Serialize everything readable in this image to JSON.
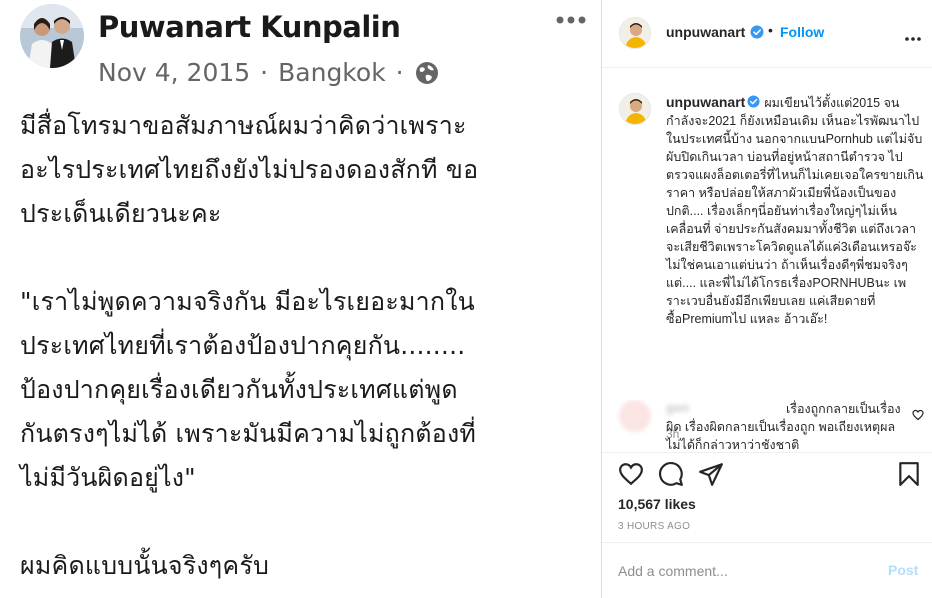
{
  "post_image": {
    "author": "Puwanart Kunpalin",
    "date": "Nov 4, 2015",
    "separator": "·",
    "location": "Bangkok",
    "body_lines_1": [
      "มีสื่อโทรมาขอสัมภาษณ์ผมว่าคิดว่าเพราะ",
      "อะไรประเทศไทยถึงยังไม่ปรองดองสักที  ขอ",
      "ประเด็นเดียวนะคะ"
    ],
    "body_lines_2": [
      "\"เราไม่พูดความจริงกัน มีอะไรเยอะมากใน",
      "ประเทศไทยที่เราต้องป้องปากคุยกัน........",
      "ป้องปากคุยเรื่องเดียวกันทั้งประเทศแต่พูด",
      "กันตรงๆไม่ได้  เพราะมันมีความไม่ถูกต้องที่",
      "ไม่มีวันผิดอยู่ไง\""
    ],
    "body_lines_3": [
      "ผมคิดแบบนั้นจริงๆครับ"
    ]
  },
  "header": {
    "username": "unpuwanart",
    "dot": "•",
    "follow_label": "Follow"
  },
  "caption": {
    "username": "unpuwanart",
    "text": "ผมเขียนไว้ตั้งแต่2015 จนกำลังจะ2021 ก็ยังเหมือนเดิม เห็นอะไรพัฒนาไปในประเทศนี้บ้าง นอกจากแบนPornhub แต่ไม่จับผับปิดเกินเวลา บ่อนที่อยู่หน้าสถานีตำรวจ ไปตรวจแผงล็อตเตอรี่ที่ไหนก็ไม่เคยเจอใครขายเกินราคา หรือปล่อยให้สภาผัวเมียพี่น้องเป็นของปกติ.... เรื่องเล็กๆนี่อยันท่าเรื่องใหญ่ๆไม่เห็นเคลื่อนที่ จ่ายประกันสังคมมาทั้งชีวิต แต่ถึงเวลาจะเสียชีวิตเพราะโควิดดูแลได้แค่3เดือนเหรอจ๊ะ ไม่ใช่คนเอาแต่บ่นว่า ถ้าเห็นเรื่องดีๆพี่ชมจริงๆ แต่.... และพี่ไม่ได้โกรธเรื่องPORNHUBนะ เพราะเวบอื่นยังมีอีกเพียบเลย แค่เสียดายที่ซื้อPremiumไป แหละ อ้าวเอ๊ะ!",
    "time": "3h"
  },
  "comment": {
    "user": "gen",
    "text": "เรื่องถูกกลายเป็นเรื่องผิด เรื่องผิดกลายเป็นเรื่องถูก พอเถียงเหตุผลไม่ได้ก็กล่าวหาว่าชังชาติ"
  },
  "actions": {
    "likes": "10,567 likes",
    "time": "3 HOURS AGO"
  },
  "comment_box": {
    "placeholder": "Add a comment...",
    "post_label": "Post"
  },
  "colors": {
    "link_blue": "#0095f6",
    "verified_blue": "#3897f0",
    "post_disabled": "#b2dffc",
    "muted": "#8e8e8e"
  },
  "icons": [
    "globe-icon",
    "more-icon",
    "verified-badge-icon",
    "heart-icon",
    "comment-icon",
    "share-icon",
    "save-icon"
  ]
}
